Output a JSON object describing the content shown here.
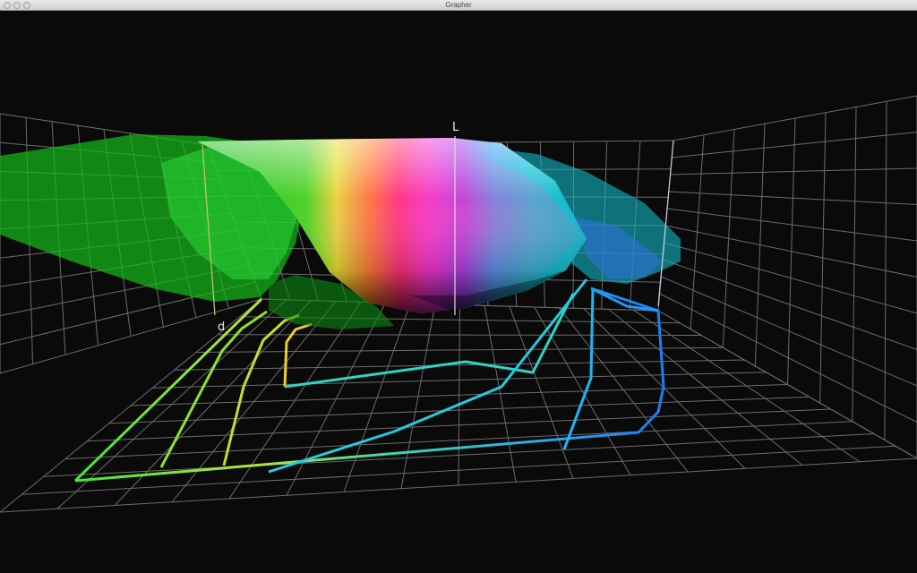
{
  "window": {
    "title": "Grapher",
    "controls": [
      "close-icon",
      "minimize-icon",
      "zoom-icon"
    ]
  },
  "plot": {
    "axis_labels": {
      "vertical": "L",
      "floor": "d"
    },
    "colors": {
      "background": "#0a0a0a",
      "grid": "#8a8a8a",
      "axis": "#dcdcdc"
    }
  }
}
